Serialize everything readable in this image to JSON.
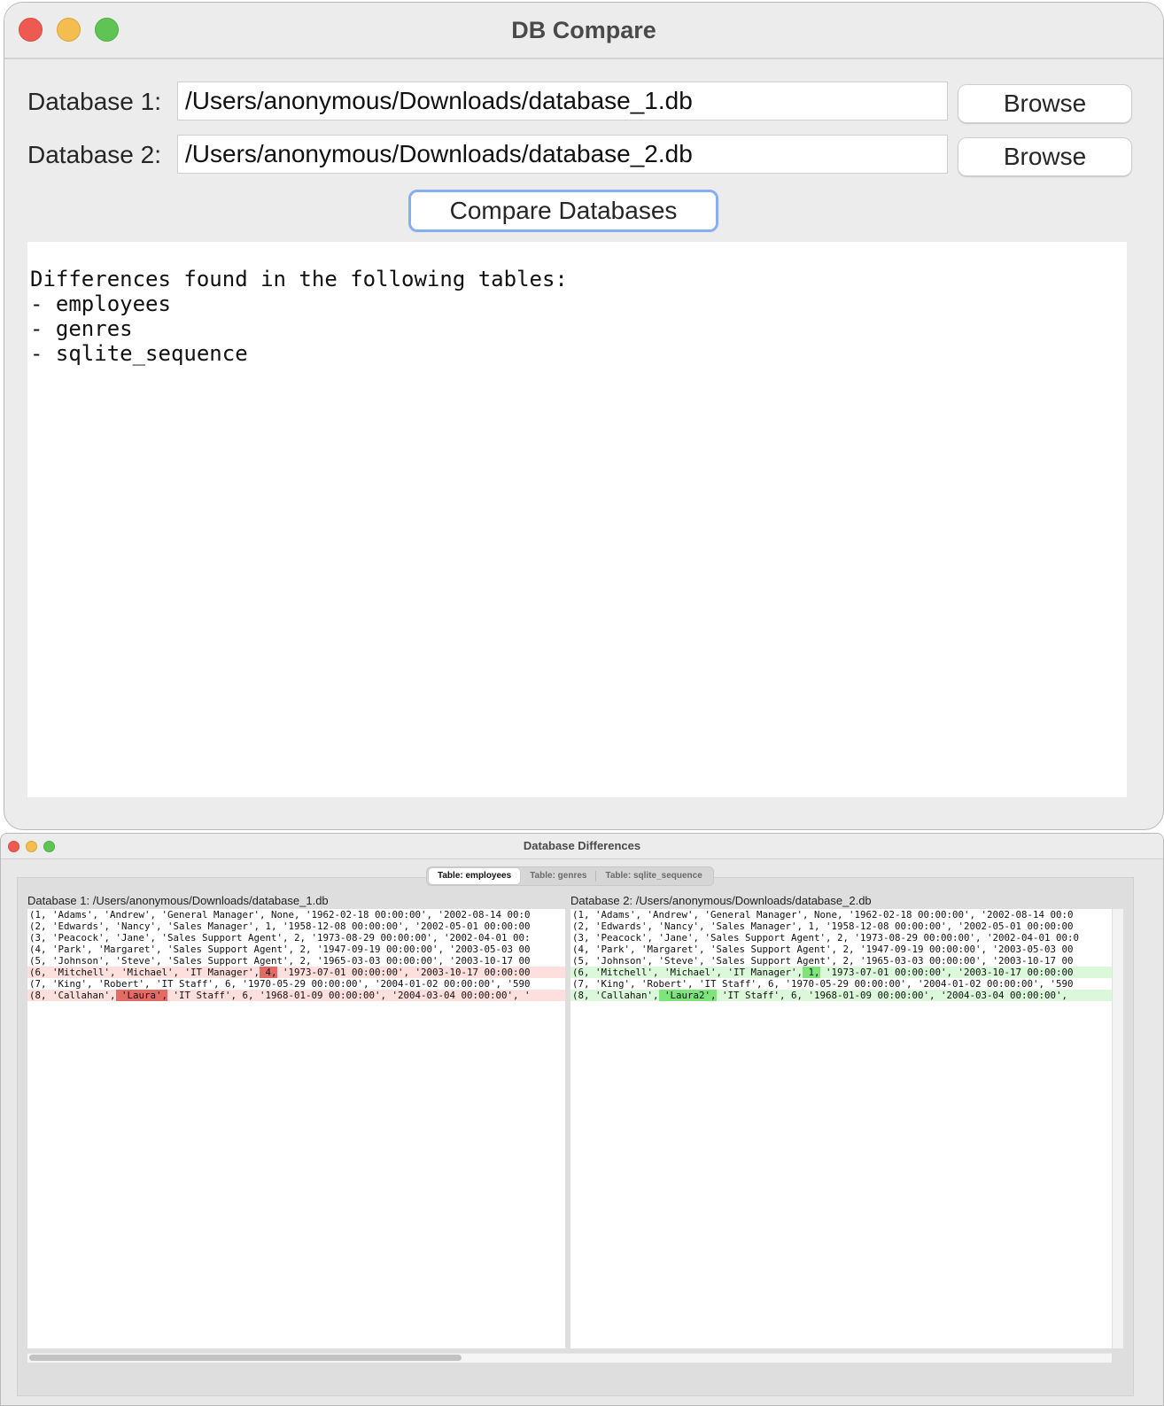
{
  "main_window": {
    "title": "DB Compare",
    "db1_label": "Database 1:",
    "db1_path": "/Users/anonymous/Downloads/database_1.db",
    "db2_label": "Database 2:",
    "db2_path": "/Users/anonymous/Downloads/database_2.db",
    "browse_label": "Browse",
    "compare_label": "Compare Databases",
    "output_lines": [
      "Differences found in the following tables:",
      "- employees",
      "- genres",
      "- sqlite_sequence"
    ]
  },
  "diff_window": {
    "title": "Database Differences",
    "tabs": [
      "Table: employees",
      "Table: genres",
      "Table: sqlite_sequence"
    ],
    "active_tab": "Table: employees",
    "left_label": "Database 1: /Users/anonymous/Downloads/database_1.db",
    "right_label": "Database 2: /Users/anonymous/Downloads/database_2.db",
    "left_rows": [
      {
        "pre": "(1, 'Adams', 'Andrew', 'General Manager', None, '1962-02-18 00:00:00', '2002-08-14 00:0",
        "hl": "",
        "post": "",
        "diff": false
      },
      {
        "pre": "(2, 'Edwards', 'Nancy', 'Sales Manager', 1, '1958-12-08 00:00:00', '2002-05-01 00:00:00",
        "hl": "",
        "post": "",
        "diff": false
      },
      {
        "pre": "(3, 'Peacock', 'Jane', 'Sales Support Agent', 2, '1973-08-29 00:00:00', '2002-04-01 00:",
        "hl": "",
        "post": "",
        "diff": false
      },
      {
        "pre": "(4, 'Park', 'Margaret', 'Sales Support Agent', 2, '1947-09-19 00:00:00', '2003-05-03 00",
        "hl": "",
        "post": "",
        "diff": false
      },
      {
        "pre": "(5, 'Johnson', 'Steve', 'Sales Support Agent', 2, '1965-03-03 00:00:00', '2003-10-17 00",
        "hl": "",
        "post": "",
        "diff": false
      },
      {
        "pre": "(6, 'Mitchell', 'Michael', 'IT Manager',",
        "hl": " 4,",
        "post": " '1973-07-01 00:00:00', '2003-10-17 00:00:00",
        "diff": true
      },
      {
        "pre": "(7, 'King', 'Robert', 'IT Staff', 6, '1970-05-29 00:00:00', '2004-01-02 00:00:00', '590",
        "hl": "",
        "post": "",
        "diff": false
      },
      {
        "pre": "(8, 'Callahan',",
        "hl": " 'Laura',",
        "post": " 'IT Staff', 6, '1968-01-09 00:00:00', '2004-03-04 00:00:00', '",
        "diff": true
      }
    ],
    "right_rows": [
      {
        "pre": "(1, 'Adams', 'Andrew', 'General Manager', None, '1962-02-18 00:00:00', '2002-08-14 00:0",
        "hl": "",
        "post": "",
        "diff": false
      },
      {
        "pre": "(2, 'Edwards', 'Nancy', 'Sales Manager', 1, '1958-12-08 00:00:00', '2002-05-01 00:00:00",
        "hl": "",
        "post": "",
        "diff": false
      },
      {
        "pre": "(3, 'Peacock', 'Jane', 'Sales Support Agent', 2, '1973-08-29 00:00:00', '2002-04-01 00:0",
        "hl": "",
        "post": "",
        "diff": false
      },
      {
        "pre": "(4, 'Park', 'Margaret', 'Sales Support Agent', 2, '1947-09-19 00:00:00', '2003-05-03 00",
        "hl": "",
        "post": "",
        "diff": false
      },
      {
        "pre": "(5, 'Johnson', 'Steve', 'Sales Support Agent', 2, '1965-03-03 00:00:00', '2003-10-17 00",
        "hl": "",
        "post": "",
        "diff": false
      },
      {
        "pre": "(6, 'Mitchell', 'Michael', 'IT Manager',",
        "hl": " 1,",
        "post": " '1973-07-01 00:00:00', '2003-10-17 00:00:00",
        "diff": true
      },
      {
        "pre": "(7, 'King', 'Robert', 'IT Staff', 6, '1970-05-29 00:00:00', '2004-01-02 00:00:00', '590",
        "hl": "",
        "post": "",
        "diff": false
      },
      {
        "pre": "(8, 'Callahan',",
        "hl": " 'Laura2',",
        "post": " 'IT Staff', 6, '1968-01-09 00:00:00', '2004-03-04 00:00:00',",
        "diff": true
      }
    ]
  },
  "colors": {
    "removed_bg": "#fde0de",
    "removed_hl": "#e36b66",
    "added_bg": "#dcf8db",
    "added_hl": "#7ee57a",
    "focus_ring": "#86aef0"
  }
}
